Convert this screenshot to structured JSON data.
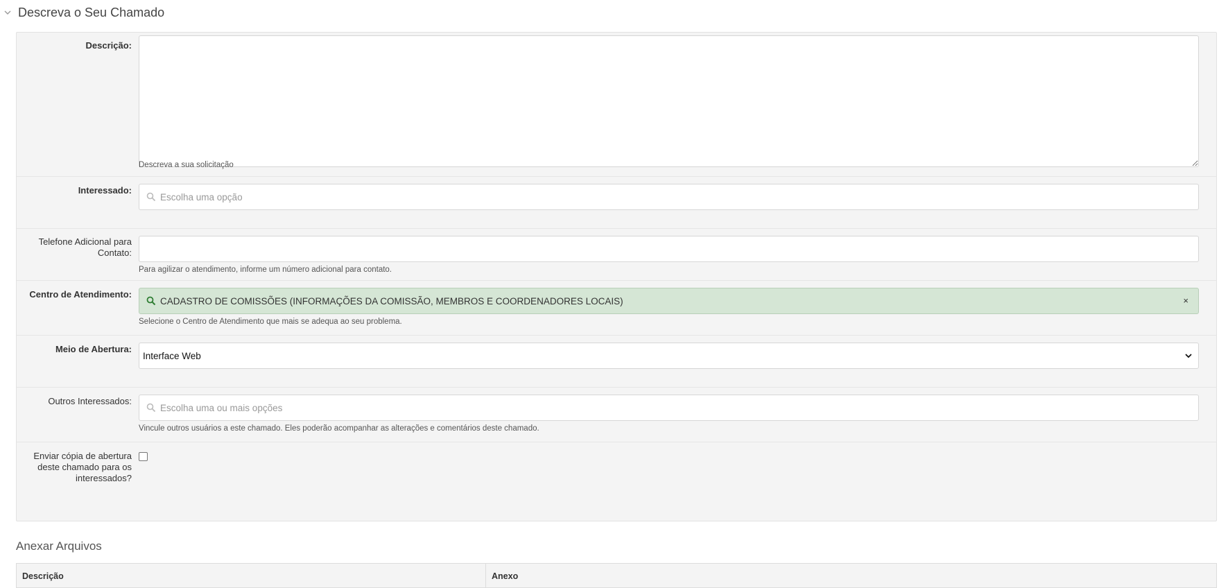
{
  "section": {
    "title": "Descreva o Seu Chamado"
  },
  "fields": {
    "descricao": {
      "label": "Descrição:",
      "help": "Descreva a sua solicitação",
      "value": ""
    },
    "interessado": {
      "label": "Interessado:",
      "placeholder": "Escolha uma opção"
    },
    "telefone": {
      "label": "Telefone Adicional para Contato:",
      "help": "Para agilizar o atendimento, informe um número adicional para contato.",
      "value": ""
    },
    "centro": {
      "label": "Centro de Atendimento:",
      "value": "CADASTRO DE COMISSÕES (INFORMAÇÕES DA COMISSÃO, MEMBROS E COORDENADORES LOCAIS)",
      "clear": "×",
      "help": "Selecione o Centro de Atendimento que mais se adequa ao seu problema."
    },
    "meio": {
      "label": "Meio de Abertura:",
      "value": "Interface Web"
    },
    "outros": {
      "label": "Outros Interessados:",
      "placeholder": "Escolha uma ou mais opções",
      "help": "Vincule outros usuários a este chamado. Eles poderão acompanhar as alterações e comentários deste chamado."
    },
    "copia": {
      "label": "Enviar cópia de abertura deste chamado para os interessados?",
      "checked": false
    }
  },
  "attachments": {
    "title": "Anexar Arquivos",
    "columns": [
      "Descrição",
      "Anexo"
    ]
  },
  "colors": {
    "selected_bg": "#d5e6d5",
    "search_icon_selected": "#2e7d32",
    "fieldset_bg": "#f4f4f4"
  }
}
